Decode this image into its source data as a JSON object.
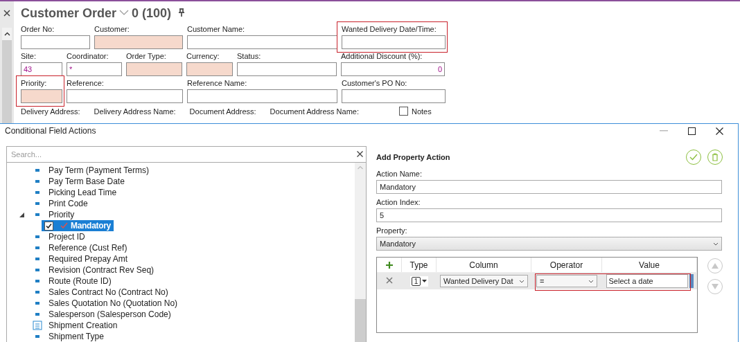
{
  "form": {
    "title": "Customer Order",
    "record": "0 (100)",
    "fields": [
      {
        "label": "Order No:",
        "kind": "text",
        "required": false,
        "highlighted": false
      },
      {
        "label": "Customer:",
        "kind": "text",
        "required": true,
        "highlighted": false
      },
      {
        "label": "Customer Name:",
        "kind": "text",
        "required": false,
        "highlighted": false
      },
      {
        "label": "Wanted Delivery Date/Time:",
        "kind": "text",
        "required": false,
        "highlighted": true
      },
      {
        "label": "Site:",
        "value": "43",
        "kind": "text",
        "required": false,
        "highlighted": false
      },
      {
        "label": "Coordinator:",
        "value": "*",
        "kind": "text",
        "required": false,
        "highlighted": false
      },
      {
        "label": "Order Type:",
        "kind": "text",
        "required": true,
        "highlighted": false
      },
      {
        "label": "Currency:",
        "kind": "text",
        "required": true,
        "highlighted": false
      },
      {
        "label": "Status:",
        "kind": "text",
        "required": false,
        "highlighted": false
      },
      {
        "label": "Additional Discount (%):",
        "value": "0",
        "kind": "number",
        "required": false,
        "highlighted": false
      },
      {
        "label": "Priority:",
        "kind": "text",
        "required": true,
        "highlighted": true
      },
      {
        "label": "Reference:",
        "kind": "text",
        "required": false,
        "highlighted": false
      },
      {
        "label": "Reference Name:",
        "kind": "text",
        "required": false,
        "highlighted": false
      },
      {
        "label": "Customer's PO No:",
        "kind": "text",
        "required": false,
        "highlighted": false
      }
    ],
    "more_labels": [
      "Delivery Address:",
      "Delivery Address Name:",
      "Document Address:",
      "Document Address Name:"
    ],
    "notes": {
      "label": "Notes",
      "checked": false
    }
  },
  "dialog": {
    "title": "Conditional Field Actions",
    "search": {
      "placeholder": "Search..."
    },
    "tree": [
      {
        "label": "Pay Term (Payment Terms)",
        "kind": "field",
        "expanded": false
      },
      {
        "label": "Pay Term Base Date",
        "kind": "field",
        "expanded": false
      },
      {
        "label": "Picking Lead Time",
        "kind": "field",
        "expanded": false
      },
      {
        "label": "Print Code",
        "kind": "field",
        "expanded": false
      },
      {
        "label": "Priority",
        "kind": "field",
        "expanded": true,
        "children": [
          {
            "label": "Mandatory",
            "checked": true,
            "selected": true
          }
        ]
      },
      {
        "label": "Project ID",
        "kind": "field",
        "expanded": false
      },
      {
        "label": "Reference (Cust Ref)",
        "kind": "field",
        "expanded": false
      },
      {
        "label": "Required Prepay Amt",
        "kind": "field",
        "expanded": false
      },
      {
        "label": "Revision (Contract Rev Seq)",
        "kind": "field",
        "expanded": false
      },
      {
        "label": "Route (Route ID)",
        "kind": "field",
        "expanded": false
      },
      {
        "label": "Sales Contract No (Contract No)",
        "kind": "field",
        "expanded": false
      },
      {
        "label": "Sales Quotation No (Quotation No)",
        "kind": "field",
        "expanded": false
      },
      {
        "label": "Salesperson (Salesperson Code)",
        "kind": "field",
        "expanded": false
      },
      {
        "label": "Shipment Creation",
        "kind": "list",
        "expanded": false
      },
      {
        "label": "Shipment Type",
        "kind": "field",
        "expanded": false
      }
    ],
    "editor": {
      "heading": "Add Property Action",
      "fields": [
        {
          "label": "Action Name:",
          "value": "Mandatory",
          "kind": "input"
        },
        {
          "label": "Action Index:",
          "value": "5",
          "kind": "input"
        },
        {
          "label": "Property:",
          "value": "Mandatory",
          "kind": "select"
        }
      ],
      "conditions": {
        "columns": [
          "Type",
          "Column",
          "Operator",
          "Value"
        ],
        "rows": [
          {
            "type": "1",
            "column": "Wanted Delivery Dat",
            "operator": "=",
            "value_placeholder": "Select a date",
            "highlighted": true
          }
        ]
      }
    }
  }
}
